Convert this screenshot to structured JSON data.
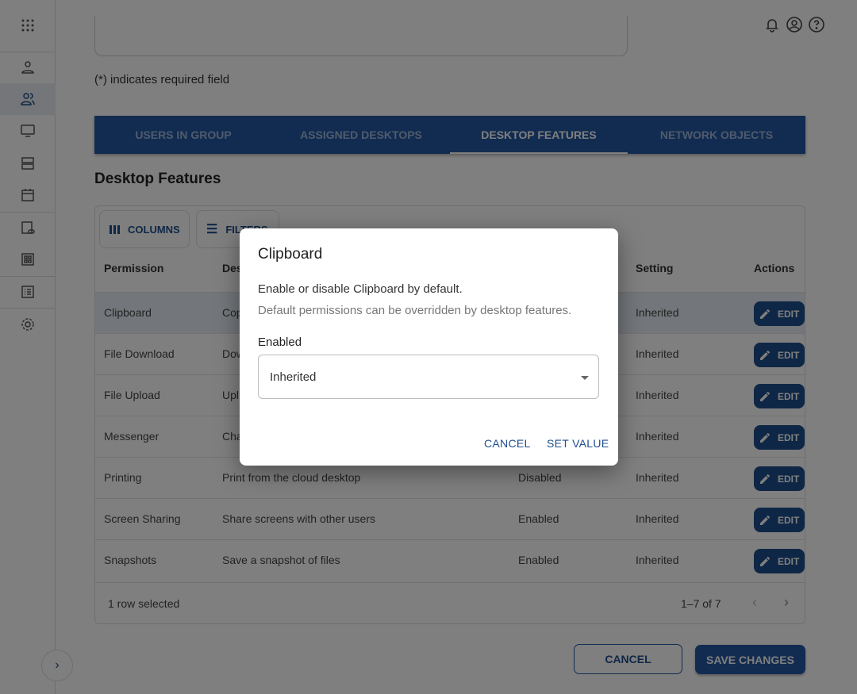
{
  "header": {
    "icons": [
      "notification-bell-icon",
      "account-icon",
      "help-icon"
    ]
  },
  "sidebar": {
    "items": [
      "apps-grid",
      "user",
      "users-group",
      "desktop",
      "servers",
      "calendar",
      "app-link",
      "dashboard",
      "list",
      "settings"
    ],
    "selected": "users-group"
  },
  "form": {
    "required_note": "(*) indicates required field"
  },
  "tabs": [
    {
      "label": "USERS IN GROUP"
    },
    {
      "label": "ASSIGNED DESKTOPS"
    },
    {
      "label": "DESKTOP FEATURES",
      "active": true
    },
    {
      "label": "NETWORK OBJECTS"
    }
  ],
  "section_title": "Desktop Features",
  "grid": {
    "toolbar": {
      "columns": "COLUMNS",
      "filters": "FILTERS"
    },
    "headers": {
      "permission": "Permission",
      "description": "Des",
      "status": "",
      "setting": "Setting",
      "actions": "Actions"
    },
    "rows": [
      {
        "permission": "Clipboard",
        "description": "Cop",
        "status": "",
        "setting": "Inherited",
        "action": "EDIT",
        "selected": true
      },
      {
        "permission": "File Download",
        "description": "Dow",
        "status": "",
        "setting": "Inherited",
        "action": "EDIT"
      },
      {
        "permission": "File Upload",
        "description": "Upl",
        "status": "",
        "setting": "Inherited",
        "action": "EDIT"
      },
      {
        "permission": "Messenger",
        "description": "Cha",
        "status": "",
        "setting": "Inherited",
        "action": "EDIT"
      },
      {
        "permission": "Printing",
        "description": "Print from the cloud desktop",
        "status": "Disabled",
        "setting": "Inherited",
        "action": "EDIT"
      },
      {
        "permission": "Screen Sharing",
        "description": "Share screens with other users",
        "status": "Enabled",
        "setting": "Inherited",
        "action": "EDIT"
      },
      {
        "permission": "Snapshots",
        "description": "Save a snapshot of files",
        "status": "Enabled",
        "setting": "Inherited",
        "action": "EDIT"
      }
    ],
    "footer": {
      "selected": "1 row selected",
      "pagination": "1–7 of 7"
    }
  },
  "actions": {
    "cancel": "CANCEL",
    "save": "SAVE CHANGES"
  },
  "dialog": {
    "title": "Clipboard",
    "description": "Enable or disable Clipboard by default.",
    "subtext": "Default permissions can be overridden by desktop features.",
    "field_label": "Enabled",
    "field_value": "Inherited",
    "cancel": "CANCEL",
    "confirm": "SET VALUE"
  },
  "colors": {
    "primary": "#2558a3"
  }
}
